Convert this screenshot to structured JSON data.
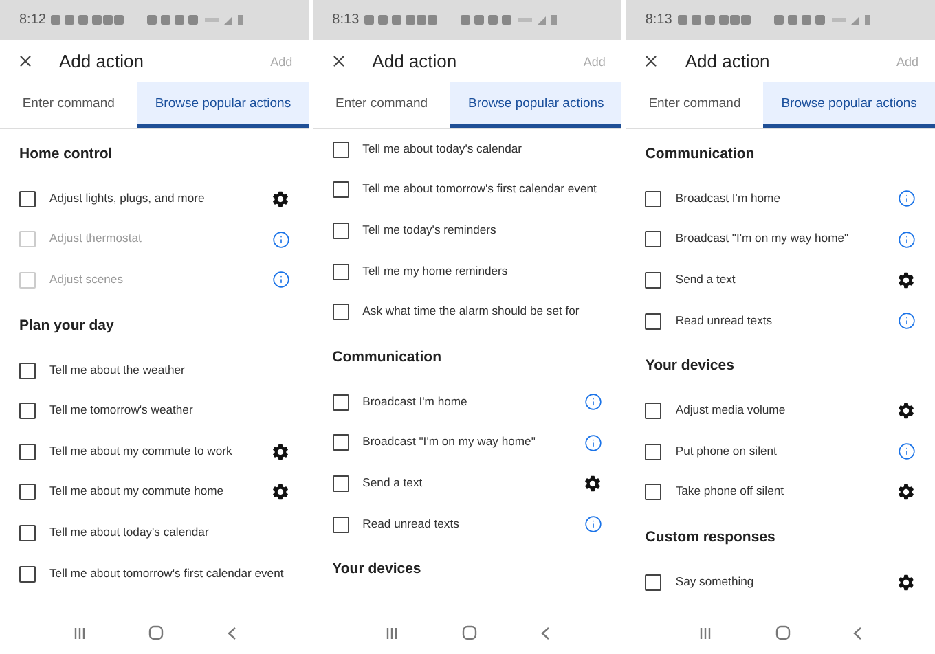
{
  "phones": [
    {
      "status_time": "8:12",
      "title": "Add action",
      "add_label": "Add",
      "tabs": [
        {
          "label": "Enter command",
          "selected": false
        },
        {
          "label": "Browse popular actions",
          "selected": true
        }
      ],
      "items": [
        {
          "kind": "heading",
          "label": "Home control"
        },
        {
          "kind": "action",
          "label": "Adjust lights, plugs, and more",
          "checked": false,
          "disabled": false,
          "has_settings": true,
          "has_info": false
        },
        {
          "kind": "action",
          "label": "Adjust thermostat",
          "checked": false,
          "disabled": true,
          "has_settings": false,
          "has_info": true
        },
        {
          "kind": "action",
          "label": "Adjust scenes",
          "checked": false,
          "disabled": true,
          "has_settings": false,
          "has_info": true
        },
        {
          "kind": "heading",
          "label": "Plan your day"
        },
        {
          "kind": "action",
          "label": "Tell me about the weather",
          "checked": false,
          "disabled": false,
          "has_settings": false,
          "has_info": false
        },
        {
          "kind": "action",
          "label": "Tell me tomorrow's weather",
          "checked": false,
          "disabled": false,
          "has_settings": false,
          "has_info": false
        },
        {
          "kind": "action",
          "label": "Tell me about my commute to work",
          "checked": false,
          "disabled": false,
          "has_settings": true,
          "has_info": false
        },
        {
          "kind": "action",
          "label": "Tell me about my commute home",
          "checked": false,
          "disabled": false,
          "has_settings": true,
          "has_info": false
        },
        {
          "kind": "action",
          "label": "Tell me about today's calendar",
          "checked": false,
          "disabled": false,
          "has_settings": false,
          "has_info": false
        },
        {
          "kind": "action",
          "label": "Tell me about tomorrow's first calendar event",
          "checked": false,
          "disabled": false,
          "has_settings": false,
          "has_info": false
        }
      ]
    },
    {
      "status_time": "8:13",
      "title": "Add action",
      "add_label": "Add",
      "tabs": [
        {
          "label": "Enter command",
          "selected": false
        },
        {
          "label": "Browse popular actions",
          "selected": true
        }
      ],
      "items": [
        {
          "kind": "action",
          "label": "Tell me about today's calendar",
          "checked": false,
          "disabled": false,
          "has_settings": false,
          "has_info": false
        },
        {
          "kind": "action",
          "label": "Tell me about tomorrow's first calendar event",
          "checked": false,
          "disabled": false,
          "has_settings": false,
          "has_info": false
        },
        {
          "kind": "action",
          "label": "Tell me today's reminders",
          "checked": false,
          "disabled": false,
          "has_settings": false,
          "has_info": false
        },
        {
          "kind": "action",
          "label": "Tell me my home reminders",
          "checked": false,
          "disabled": false,
          "has_settings": false,
          "has_info": false
        },
        {
          "kind": "action",
          "label": "Ask what time the alarm should be set for",
          "checked": false,
          "disabled": false,
          "has_settings": false,
          "has_info": false
        },
        {
          "kind": "heading",
          "label": "Communication"
        },
        {
          "kind": "action",
          "label": "Broadcast I'm home",
          "checked": false,
          "disabled": false,
          "has_settings": false,
          "has_info": true
        },
        {
          "kind": "action",
          "label": "Broadcast \"I'm on my way home\"",
          "checked": false,
          "disabled": false,
          "has_settings": false,
          "has_info": true
        },
        {
          "kind": "action",
          "label": "Send a text",
          "checked": false,
          "disabled": false,
          "has_settings": true,
          "has_info": false
        },
        {
          "kind": "action",
          "label": "Read unread texts",
          "checked": false,
          "disabled": false,
          "has_settings": false,
          "has_info": true
        },
        {
          "kind": "heading",
          "label": "Your devices"
        }
      ]
    },
    {
      "status_time": "8:13",
      "title": "Add action",
      "add_label": "Add",
      "tabs": [
        {
          "label": "Enter command",
          "selected": false
        },
        {
          "label": "Browse popular actions",
          "selected": true
        }
      ],
      "items": [
        {
          "kind": "heading",
          "label": "Communication"
        },
        {
          "kind": "action",
          "label": "Broadcast I'm home",
          "checked": false,
          "disabled": false,
          "has_settings": false,
          "has_info": true
        },
        {
          "kind": "action",
          "label": "Broadcast \"I'm on my way home\"",
          "checked": false,
          "disabled": false,
          "has_settings": false,
          "has_info": true
        },
        {
          "kind": "action",
          "label": "Send a text",
          "checked": false,
          "disabled": false,
          "has_settings": true,
          "has_info": false
        },
        {
          "kind": "action",
          "label": "Read unread texts",
          "checked": false,
          "disabled": false,
          "has_settings": false,
          "has_info": true
        },
        {
          "kind": "heading",
          "label": "Your devices"
        },
        {
          "kind": "action",
          "label": "Adjust media volume",
          "checked": false,
          "disabled": false,
          "has_settings": true,
          "has_info": false
        },
        {
          "kind": "action",
          "label": "Put phone on silent",
          "checked": false,
          "disabled": false,
          "has_settings": false,
          "has_info": true
        },
        {
          "kind": "action",
          "label": "Take phone off silent",
          "checked": false,
          "disabled": false,
          "has_settings": true,
          "has_info": false
        },
        {
          "kind": "heading",
          "label": "Custom responses"
        },
        {
          "kind": "action",
          "label": "Say something",
          "checked": false,
          "disabled": false,
          "has_settings": true,
          "has_info": false
        }
      ]
    }
  ]
}
